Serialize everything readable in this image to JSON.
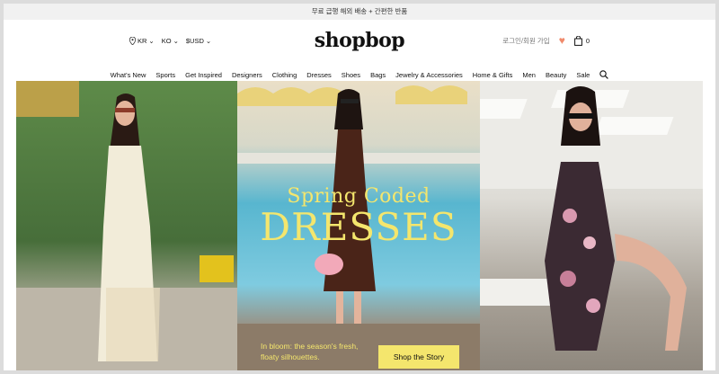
{
  "promo": {
    "text": "무료 급행 해외 배송 + 간편한 반품"
  },
  "header": {
    "logo": "shopbop",
    "locale": {
      "country": "KR",
      "language": "KO",
      "currency": "$USD"
    },
    "account": {
      "login": "로그인/회원 가입",
      "bag_count": "0"
    }
  },
  "nav": {
    "items": [
      "What's New",
      "Sports",
      "Get Inspired",
      "Designers",
      "Clothing",
      "Dresses",
      "Shoes",
      "Bags",
      "Jewelry & Accessories",
      "Home & Gifts",
      "Men",
      "Beauty",
      "Sale"
    ]
  },
  "hero": {
    "headline_line1": "Spring Coded",
    "headline_line2": "DRESSES",
    "caption": "In bloom: the season's fresh, floaty silhouettes.",
    "cta": "Shop the Story"
  },
  "colors": {
    "accent": "#f4e66d",
    "heart": "#f08a6b",
    "promo_bg": "#f1f1f1"
  },
  "icons": [
    "location-pin-icon",
    "chevron-down-icon",
    "heart-icon",
    "shopping-bag-icon",
    "search-icon"
  ]
}
